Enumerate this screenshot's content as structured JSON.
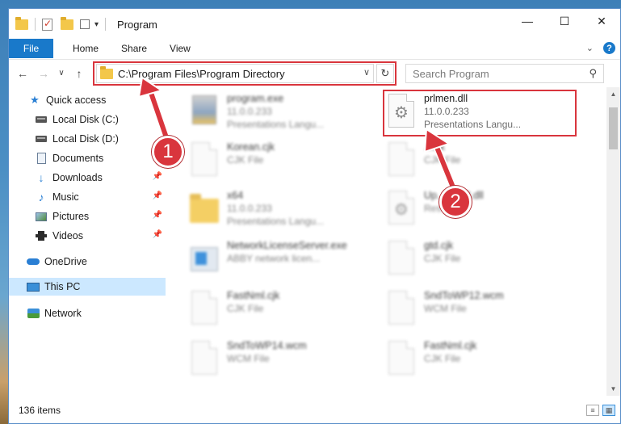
{
  "window": {
    "title": "Program",
    "controls": {
      "minimize": "—",
      "maximize": "☐",
      "close": "✕"
    }
  },
  "ribbon": {
    "tabs": [
      "File",
      "Home",
      "Share",
      "View"
    ],
    "help": "?"
  },
  "address": {
    "path": "C:\\Program Files\\Program Directory"
  },
  "search": {
    "placeholder": "Search Program"
  },
  "nav": {
    "items": [
      {
        "label": "Quick access",
        "icon": "star-icon"
      },
      {
        "label": "Local Disk (C:)",
        "icon": "disk-icon"
      },
      {
        "label": "Local Disk (D:)",
        "icon": "disk-icon"
      },
      {
        "label": "Documents",
        "icon": "documents-icon"
      },
      {
        "label": "Downloads",
        "icon": "downloads-icon"
      },
      {
        "label": "Music",
        "icon": "music-icon"
      },
      {
        "label": "Pictures",
        "icon": "pictures-icon"
      },
      {
        "label": "Videos",
        "icon": "videos-icon"
      },
      {
        "label": "OneDrive",
        "icon": "onedrive-icon"
      },
      {
        "label": "This PC",
        "icon": "this-pc-icon"
      },
      {
        "label": "Network",
        "icon": "network-icon"
      }
    ]
  },
  "files": [
    {
      "name": "program.exe",
      "sub1": "11.0.0.233",
      "sub2": "Presentations Langu...",
      "icon": "setup-icon"
    },
    {
      "name": "prlmen.dll",
      "sub1": "11.0.0.233",
      "sub2": "Presentations Langu...",
      "icon": "dll-gear-icon"
    },
    {
      "name": "Korean.cjk",
      "sub1": "CJK File",
      "icon": "file-icon"
    },
    {
      "name": "...cjk",
      "sub1": "CJK File",
      "icon": "file-icon"
    },
    {
      "name": "x64",
      "sub1": "11.0.0.233",
      "sub2": "Presentations Langu...",
      "icon": "folder-icon"
    },
    {
      "name": "Up...ent63.dll",
      "sub1": "Res...LL",
      "icon": "dll-gear-icon"
    },
    {
      "name": "NetworkLicenseServer.exe",
      "sub1": "ABBY network licen...",
      "icon": "exe-icon"
    },
    {
      "name": "gtd.cjk",
      "sub1": "CJK File",
      "icon": "file-icon"
    },
    {
      "name": "FastNml.cjk",
      "sub1": "CJK File",
      "icon": "file-icon"
    },
    {
      "name": "SndToWP12.wcm",
      "sub1": "WCM File",
      "icon": "file-icon"
    },
    {
      "name": "SndToWP14.wcm",
      "sub1": "WCM File",
      "icon": "file-icon"
    },
    {
      "name": "FastNml.cjk",
      "sub1": "CJK File",
      "icon": "file-icon"
    }
  ],
  "status": {
    "item_count": "136 items"
  },
  "annotations": {
    "badge1": "1",
    "badge2": "2",
    "color": "#d9353d"
  }
}
